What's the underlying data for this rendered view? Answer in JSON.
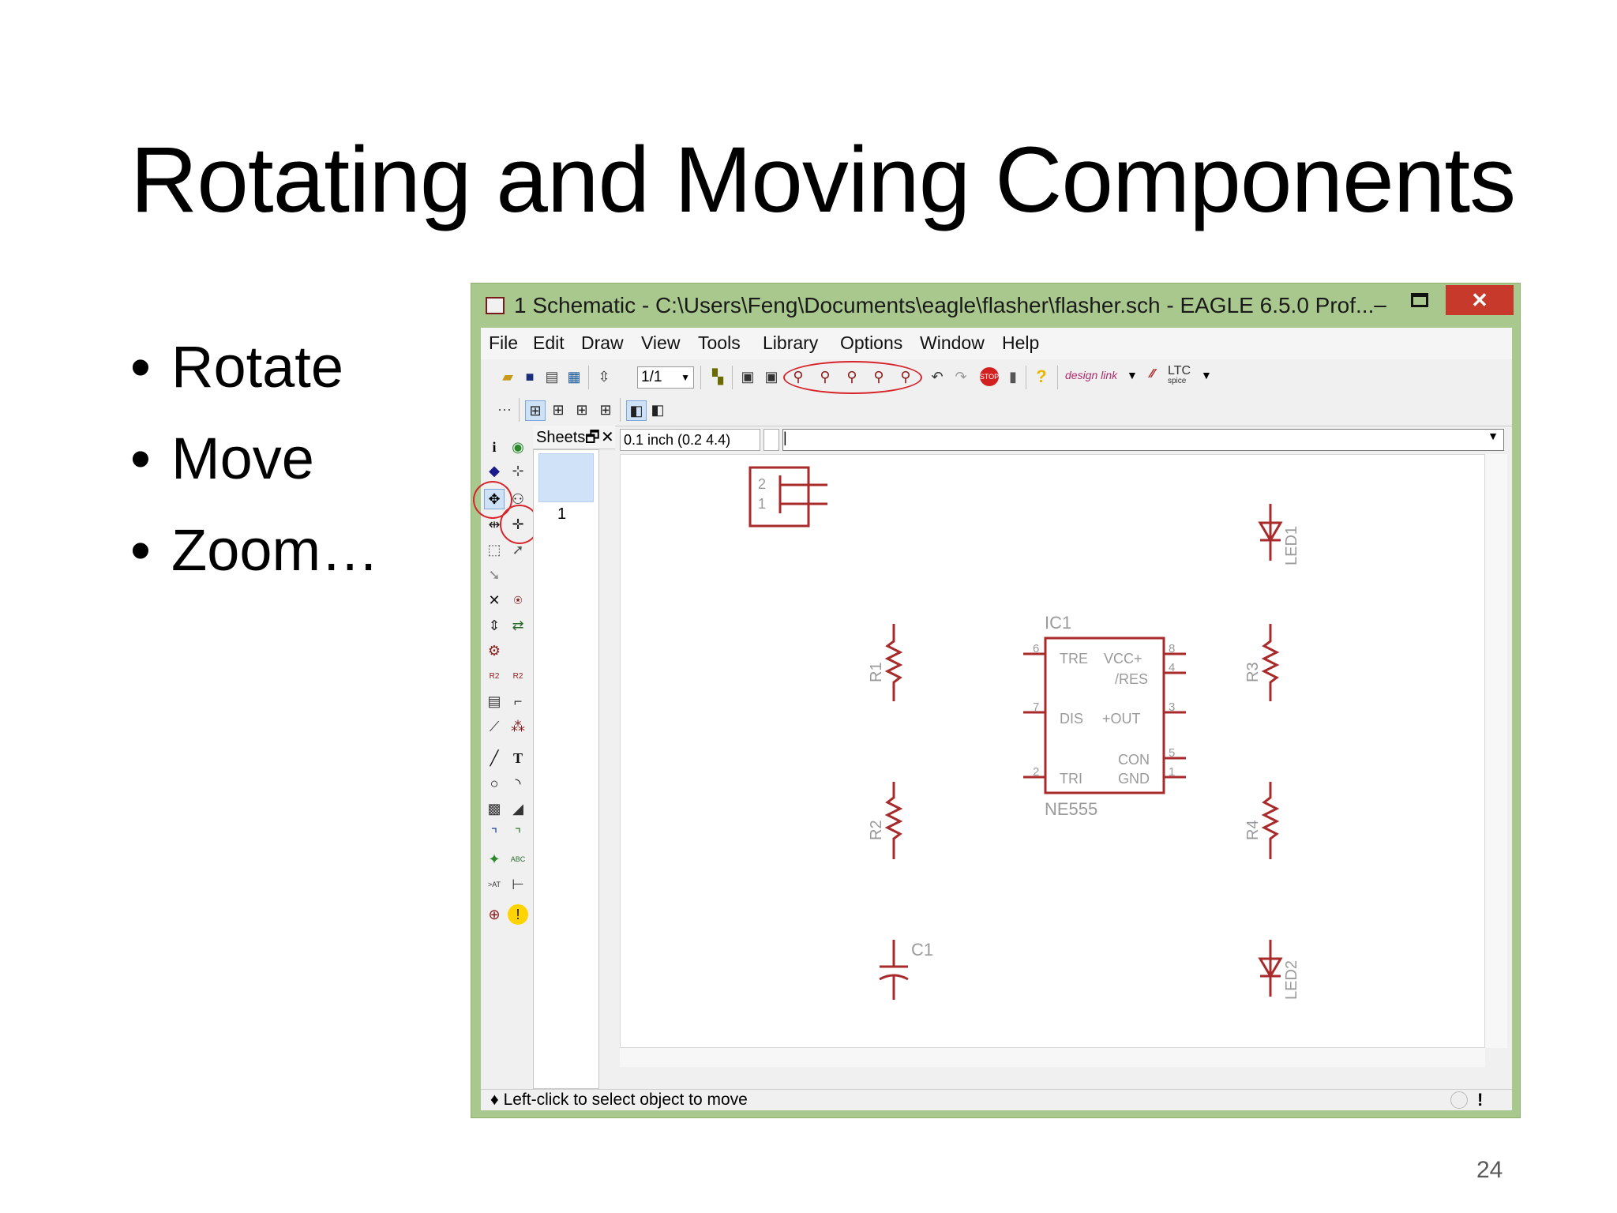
{
  "slide": {
    "title": "Rotating and Moving Components",
    "bullets": [
      "Rotate",
      "Move",
      "Zoom…"
    ],
    "page_number": "24"
  },
  "window": {
    "title": "1 Schematic - C:\\Users\\Feng\\Documents\\eagle\\flasher\\flasher.sch - EAGLE 6.5.0 Prof...",
    "menu": [
      "File",
      "Edit",
      "Draw",
      "View",
      "Tools",
      "Library",
      "Options",
      "Window",
      "Help"
    ],
    "sheet_selector": "1/1",
    "designlink_label": "design link",
    "ltc_label": "LTC",
    "ltc_sub": "spice",
    "sheets_tab": "Sheets",
    "sheet_number": "1",
    "grid_readout": "0.1 inch (0.2 4.4)",
    "command_value": "|",
    "status": "Left-click to select object to move"
  },
  "schematic": {
    "connector_pins": [
      "2",
      "1"
    ],
    "ic": {
      "name": "IC1",
      "value": "NE555",
      "pins_left": [
        "6",
        "7",
        "2"
      ],
      "pins_right": [
        "8",
        "4",
        "3",
        "5",
        "1"
      ],
      "labels": [
        "TRE",
        "VCC+",
        "/RES",
        "DIS",
        "+OUT",
        "CON",
        "TRI",
        "GND"
      ]
    },
    "resistors": [
      "R1",
      "R2",
      "R3",
      "R4"
    ],
    "capacitor": "C1",
    "leds": [
      "LED1",
      "LED2"
    ]
  },
  "colors": {
    "schematic_line": "#a82a2a",
    "highlight_circle": "#d6242a",
    "titlebar": "#a9c88e",
    "close_button": "#c7392b"
  }
}
